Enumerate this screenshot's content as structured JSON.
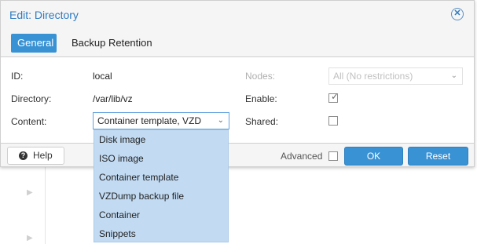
{
  "dialog": {
    "title": "Edit: Directory",
    "tabs": [
      {
        "label": "General",
        "active": true
      },
      {
        "label": "Backup Retention",
        "active": false
      }
    ]
  },
  "form": {
    "id_label": "ID:",
    "id_value": "local",
    "directory_label": "Directory:",
    "directory_value": "/var/lib/vz",
    "content_label": "Content:",
    "content_value": "Container template, VZD",
    "nodes_label": "Nodes:",
    "nodes_value": "All (No restrictions)",
    "enable_label": "Enable:",
    "enable_checked": true,
    "shared_label": "Shared:",
    "shared_checked": false
  },
  "content_options": [
    "Disk image",
    "ISO image",
    "Container template",
    "VZDump backup file",
    "Container",
    "Snippets"
  ],
  "footer": {
    "help_label": "Help",
    "advanced_label": "Advanced",
    "advanced_checked": false,
    "ok_label": "OK",
    "reset_label": "Reset"
  },
  "colors": {
    "accent": "#3892d4",
    "title": "#2f7bc1",
    "dropdown_bg": "#c2dbf3"
  },
  "icons": [
    "close-icon",
    "help-icon",
    "chevron-down-icon",
    "checkmark-icon"
  ]
}
